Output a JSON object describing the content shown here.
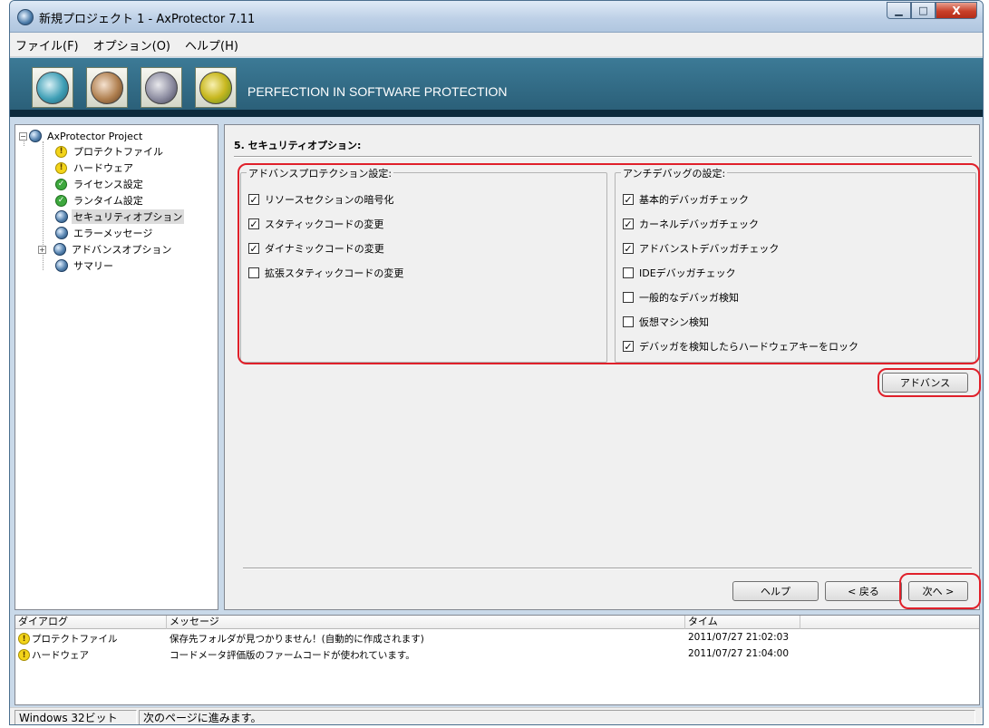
{
  "window": {
    "title": "新規プロジェクト 1 - AxProtector 7.11",
    "minimize": "▁",
    "maximize": "□",
    "close": "X"
  },
  "menu": [
    {
      "label": "ファイル(F)"
    },
    {
      "label": "オプション(O)"
    },
    {
      "label": "ヘルプ(H)"
    }
  ],
  "banner": {
    "text": "PERFECTION IN SOFTWARE PROTECTION",
    "tools": [
      "wizard-icon",
      "document-icon",
      "wand-icon",
      "gear-icon"
    ]
  },
  "tree": {
    "root": "AxProtector Project",
    "items": [
      {
        "label": "プロテクトファイル",
        "icon": "warning-icon"
      },
      {
        "label": "ハードウェア",
        "icon": "warning-icon"
      },
      {
        "label": "ライセンス設定",
        "icon": "check-icon"
      },
      {
        "label": "ランタイム設定",
        "icon": "check-icon"
      },
      {
        "label": "セキュリティオプション",
        "icon": "globe-icon",
        "selected": true
      },
      {
        "label": "エラーメッセージ",
        "icon": "globe-icon"
      },
      {
        "label": "アドバンスオプション",
        "icon": "globe-icon",
        "expandable": true
      },
      {
        "label": "サマリー",
        "icon": "globe-icon"
      }
    ]
  },
  "main": {
    "title": "5. セキュリティオプション:",
    "advanced_group": {
      "title": "アドバンスプロテクション設定:",
      "options": [
        {
          "label": "リソースセクションの暗号化",
          "checked": true
        },
        {
          "label": "スタティックコードの変更",
          "checked": true
        },
        {
          "label": "ダイナミックコードの変更",
          "checked": true
        },
        {
          "label": "拡張スタティックコードの変更",
          "checked": false
        }
      ]
    },
    "antidebug_group": {
      "title": "アンチデバッグの設定:",
      "options": [
        {
          "label": "基本的デバッガチェック",
          "checked": true
        },
        {
          "label": "カーネルデバッガチェック",
          "checked": true
        },
        {
          "label": "アドバンストデバッガチェック",
          "checked": true
        },
        {
          "label": "IDEデバッガチェック",
          "checked": false
        },
        {
          "label": "一般的なデバッガ検知",
          "checked": false
        },
        {
          "label": "仮想マシン検知",
          "checked": false
        },
        {
          "label": "デバッガを検知したらハードウェアキーをロック",
          "checked": true
        }
      ]
    },
    "advanced_button": "アドバンス",
    "help_button": "ヘルプ",
    "back_button": "< 戻る",
    "next_button": "次へ >"
  },
  "log": {
    "columns": [
      "ダイアログ",
      "メッセージ",
      "タイム"
    ],
    "rows": [
      {
        "dialog": "プロテクトファイル",
        "message": "保存先フォルダが見つかりません！(自動的に作成されます)",
        "time": "2011/07/27 21:02:03"
      },
      {
        "dialog": "ハードウェア",
        "message": "コードメータ評価版のファームコードが使われています。",
        "time": "2011/07/27 21:04:00"
      }
    ]
  },
  "status": {
    "platform": "Windows 32ビット",
    "message": "次のページに進みます。"
  },
  "colors": {
    "highlight": "#e0202a",
    "banner": "#2f6a85"
  }
}
